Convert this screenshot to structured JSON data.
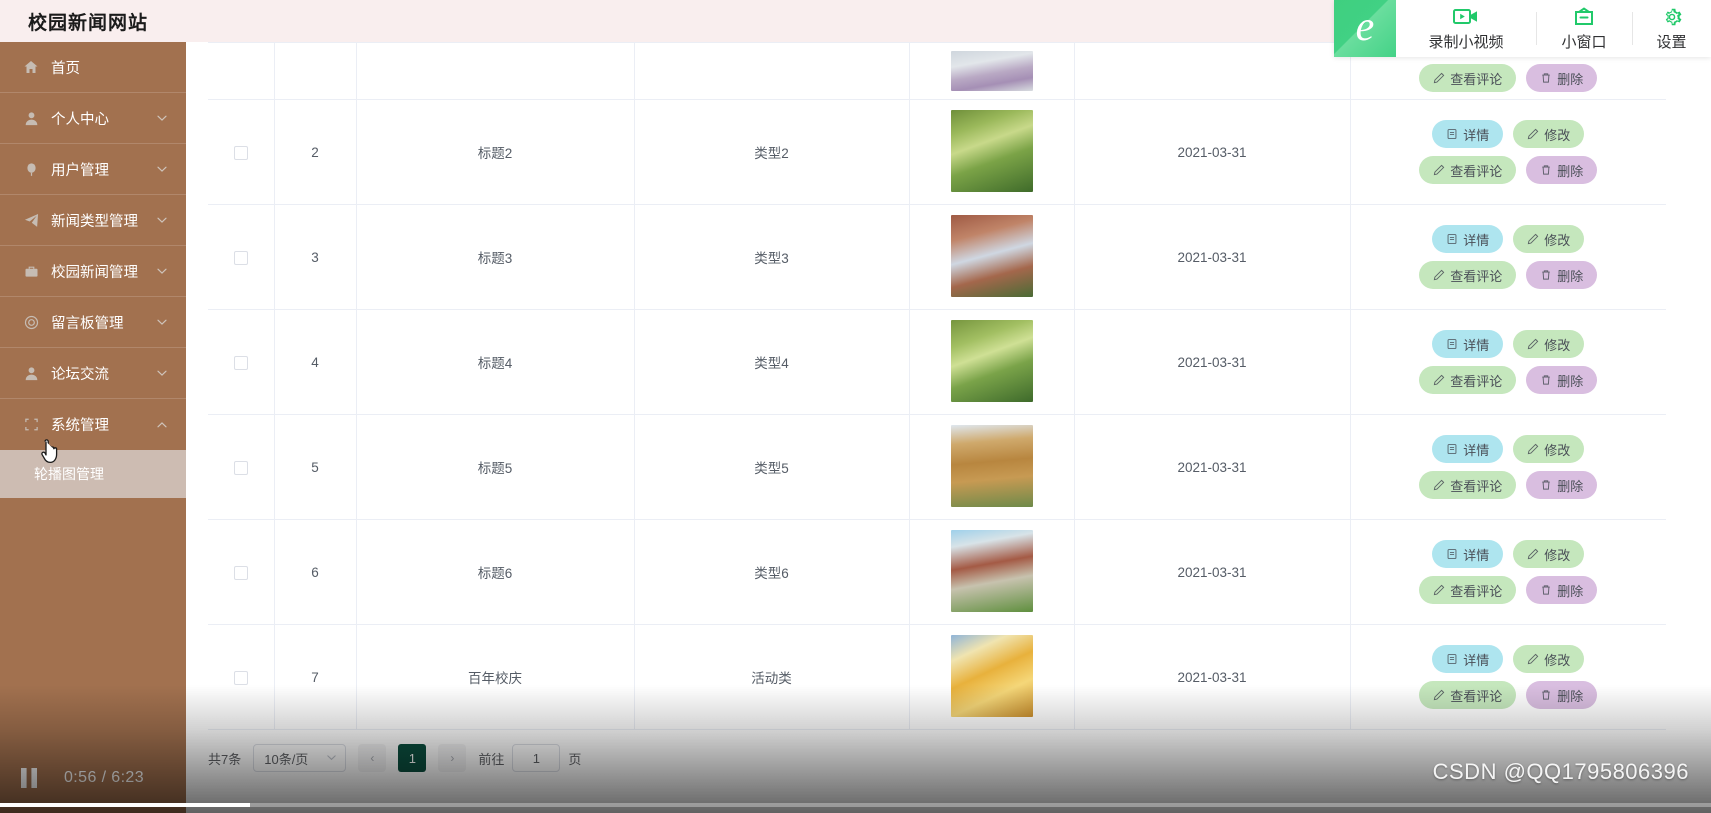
{
  "header": {
    "title": "校园新闻网站"
  },
  "sidebar": {
    "items": [
      {
        "label": "首页",
        "icon": "home-icon",
        "arrow": ""
      },
      {
        "label": "个人中心",
        "icon": "user-icon",
        "arrow": "chevron-down-icon"
      },
      {
        "label": "用户管理",
        "icon": "balloon-icon",
        "arrow": "chevron-down-icon"
      },
      {
        "label": "新闻类型管理",
        "icon": "send-icon",
        "arrow": "chevron-down-icon"
      },
      {
        "label": "校园新闻管理",
        "icon": "briefcase-icon",
        "arrow": "chevron-down-icon"
      },
      {
        "label": "留言板管理",
        "icon": "circle-icon",
        "arrow": "chevron-down-icon"
      },
      {
        "label": "论坛交流",
        "icon": "user-icon",
        "arrow": "chevron-down-icon"
      },
      {
        "label": "系统管理",
        "icon": "frame-icon",
        "arrow": "chevron-up-icon"
      }
    ],
    "submenu": [
      {
        "label": "轮播图管理",
        "active": true
      }
    ]
  },
  "table": {
    "rows": [
      {
        "id": "",
        "title": "",
        "type": "",
        "date": "",
        "clipped": true
      },
      {
        "id": "2",
        "title": "标题2",
        "type": "类型2",
        "date": "2021-03-31"
      },
      {
        "id": "3",
        "title": "标题3",
        "type": "类型3",
        "date": "2021-03-31"
      },
      {
        "id": "4",
        "title": "标题4",
        "type": "类型4",
        "date": "2021-03-31"
      },
      {
        "id": "5",
        "title": "标题5",
        "type": "类型5",
        "date": "2021-03-31"
      },
      {
        "id": "6",
        "title": "标题6",
        "type": "类型6",
        "date": "2021-03-31"
      },
      {
        "id": "7",
        "title": "百年校庆",
        "type": "活动类",
        "date": "2021-03-31"
      }
    ],
    "actions": {
      "detail": "详情",
      "edit": "修改",
      "comment": "查看评论",
      "delete": "删除"
    }
  },
  "pagination": {
    "total": "共7条",
    "page_size": "10条/页",
    "prev": "‹",
    "current_page": "1",
    "next": "›",
    "jump_label": "前往",
    "jump_value": "1",
    "jump_suffix": "页"
  },
  "recorder_bar": {
    "logo": "e",
    "record_label": "录制小视频",
    "window_label": "小窗口",
    "settings_label": "设置"
  },
  "player": {
    "current_time": "0:56",
    "separator": "/",
    "duration": "6:23",
    "time_display": "0:56 / 6:23",
    "progress_percent": 14.6
  },
  "watermark": {
    "text": "CSDN @QQ1795806396"
  },
  "colors": {
    "sidebar_bg": "#a2714f",
    "submenu_bg": "#cdbcb2",
    "header_bg": "#f9eeee",
    "btn_detail": "#aee5ef",
    "btn_edit": "#c5e7bd",
    "btn_comment": "#c5e7bd",
    "btn_delete": "#d9bee0",
    "pager_active": "#0b4f3f",
    "recorder_green": "#21c96a"
  }
}
